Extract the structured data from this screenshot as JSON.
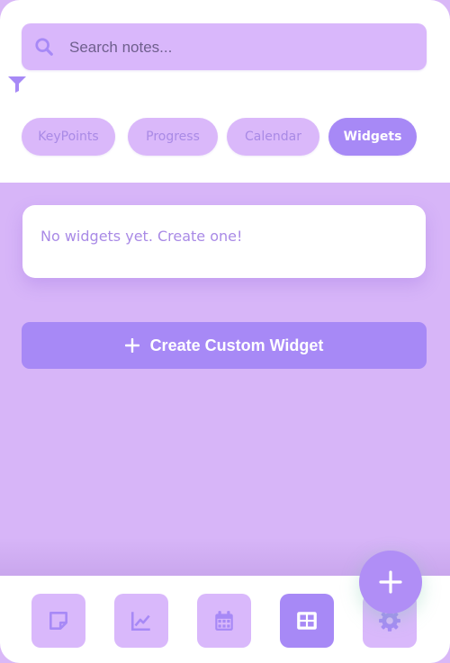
{
  "search": {
    "placeholder": "Search notes..."
  },
  "tabs": [
    {
      "label": "KeyPoints",
      "active": false
    },
    {
      "label": "Progress",
      "active": false
    },
    {
      "label": "Calendar",
      "active": false
    },
    {
      "label": "Widgets",
      "active": true
    }
  ],
  "widgets": {
    "empty_message": "No widgets yet. Create one!"
  },
  "create_button": {
    "label": "Create Custom Widget"
  },
  "fab": {
    "icon": "plus-icon"
  },
  "bottom_nav": [
    {
      "icon": "note-icon",
      "active": false
    },
    {
      "icon": "chart-icon",
      "active": false
    },
    {
      "icon": "calendar-icon",
      "active": false
    },
    {
      "icon": "grid-icon",
      "active": true
    },
    {
      "icon": "gear-icon",
      "active": false
    }
  ],
  "colors": {
    "accent": "#a789f6",
    "pill": "#dab8fa",
    "background": "#d7b5f8",
    "text_muted": "#a98ae6"
  }
}
